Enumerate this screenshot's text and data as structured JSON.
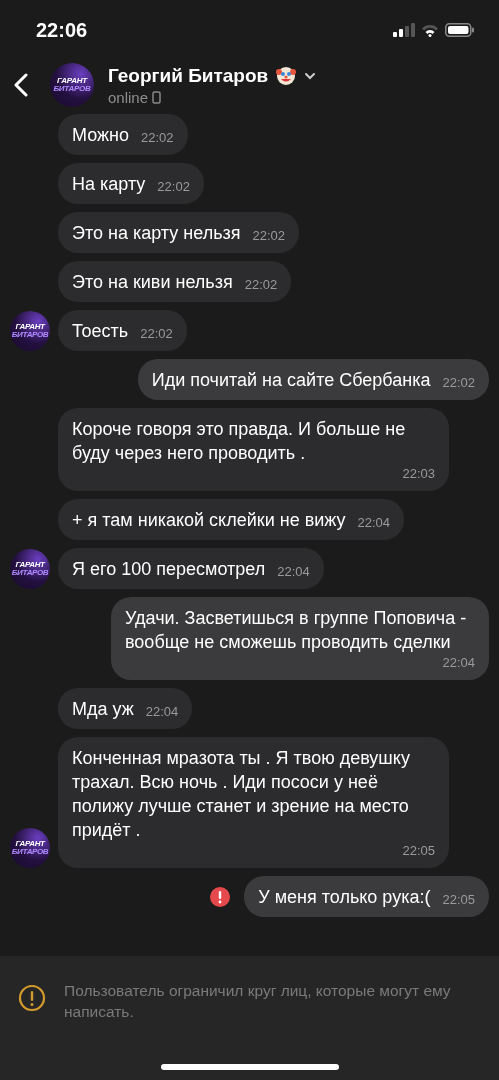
{
  "status_bar": {
    "time": "22:06"
  },
  "header": {
    "name": "Георгий Битаров",
    "status": "online",
    "avatar_text": [
      "ГАРАНТ",
      "БИТАРОВ"
    ]
  },
  "messages": [
    {
      "kind": "incoming",
      "text": "Можно",
      "time": "22:02"
    },
    {
      "kind": "incoming",
      "text": "На карту",
      "time": "22:02"
    },
    {
      "kind": "incoming",
      "text": "Это на карту нельзя",
      "time": "22:02"
    },
    {
      "kind": "incoming",
      "text": "Это на киви нельзя",
      "time": "22:02"
    },
    {
      "kind": "incoming",
      "text": "Тоесть",
      "time": "22:02",
      "avatar_text": [
        "ГАРАНТ",
        "БИТАРОВ"
      ]
    },
    {
      "kind": "outgoing",
      "text": "Иди почитай на сайте Сбербанка",
      "time": "22:02"
    },
    {
      "kind": "incoming",
      "text": "Короче говоря это правда. И больше не буду через него проводить .",
      "time": "22:03"
    },
    {
      "kind": "incoming",
      "text": "+ я там никакой склейки не вижу",
      "time": "22:04"
    },
    {
      "kind": "incoming",
      "text": "Я его 100 пересмотрел",
      "time": "22:04",
      "avatar_text": [
        "ГАРАНТ",
        "БИТАРОВ"
      ]
    },
    {
      "kind": "outgoing",
      "text": "Удачи. Засветишься в группе Поповича - вообще не сможешь проводить сделки",
      "time": "22:04"
    },
    {
      "kind": "incoming",
      "text": "Мда уж",
      "time": "22:04"
    },
    {
      "kind": "incoming",
      "text": "Конченная мразота ты . Я твою девушку трахал. Всю ночь . Иди пососи у неё полижу лучше станет и зрение на место придёт .",
      "time": "22:05",
      "avatar_text": [
        "ГАРАНТ",
        "БИТАРОВ"
      ]
    },
    {
      "kind": "failed",
      "text": "У меня только рука:(",
      "time": "22:05"
    }
  ],
  "notice": {
    "text": "Пользователь ограничил круг лиц, которые могут ему написать."
  }
}
